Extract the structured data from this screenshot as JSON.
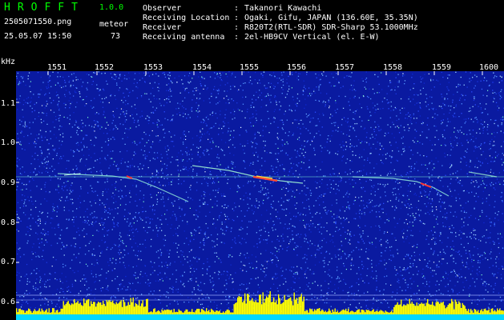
{
  "app": {
    "title": "HROFFT",
    "version": "1.0.0"
  },
  "meta": {
    "file_name": "2505071550.png",
    "timestamp": "25.05.07 15:50",
    "mode": "meteor",
    "count": "73"
  },
  "info": [
    {
      "label": "Observer",
      "value": "Takanori Kawachi"
    },
    {
      "label": "Receiving Location",
      "value": "Ogaki, Gifu, JAPAN (136.60E, 35.35N)"
    },
    {
      "label": "Receiver",
      "value": "R820T2(RTL-SDR) SDR-Sharp 53.1000MHz"
    },
    {
      "label": "Receiving antenna",
      "value": "2el-HB9CV Vertical (el. E-W)"
    }
  ],
  "axes": {
    "y_unit": "kHz",
    "x_ticks": [
      "1551",
      "1552",
      "1553",
      "1554",
      "1555",
      "1556",
      "1557",
      "1558",
      "1559",
      "1600"
    ],
    "y_ticks": [
      "1.1",
      "1.0",
      "0.9",
      "0.8",
      "0.7",
      "0.6"
    ]
  },
  "colors": {
    "background": "#000000",
    "plot_bg": "#0a1aa0",
    "title_green": "#00ff00",
    "echo_line": "#9cf0d0",
    "echo_hot": "#ff3030",
    "power_bar": "#ffff00",
    "baseline": "#00d8ff"
  }
}
